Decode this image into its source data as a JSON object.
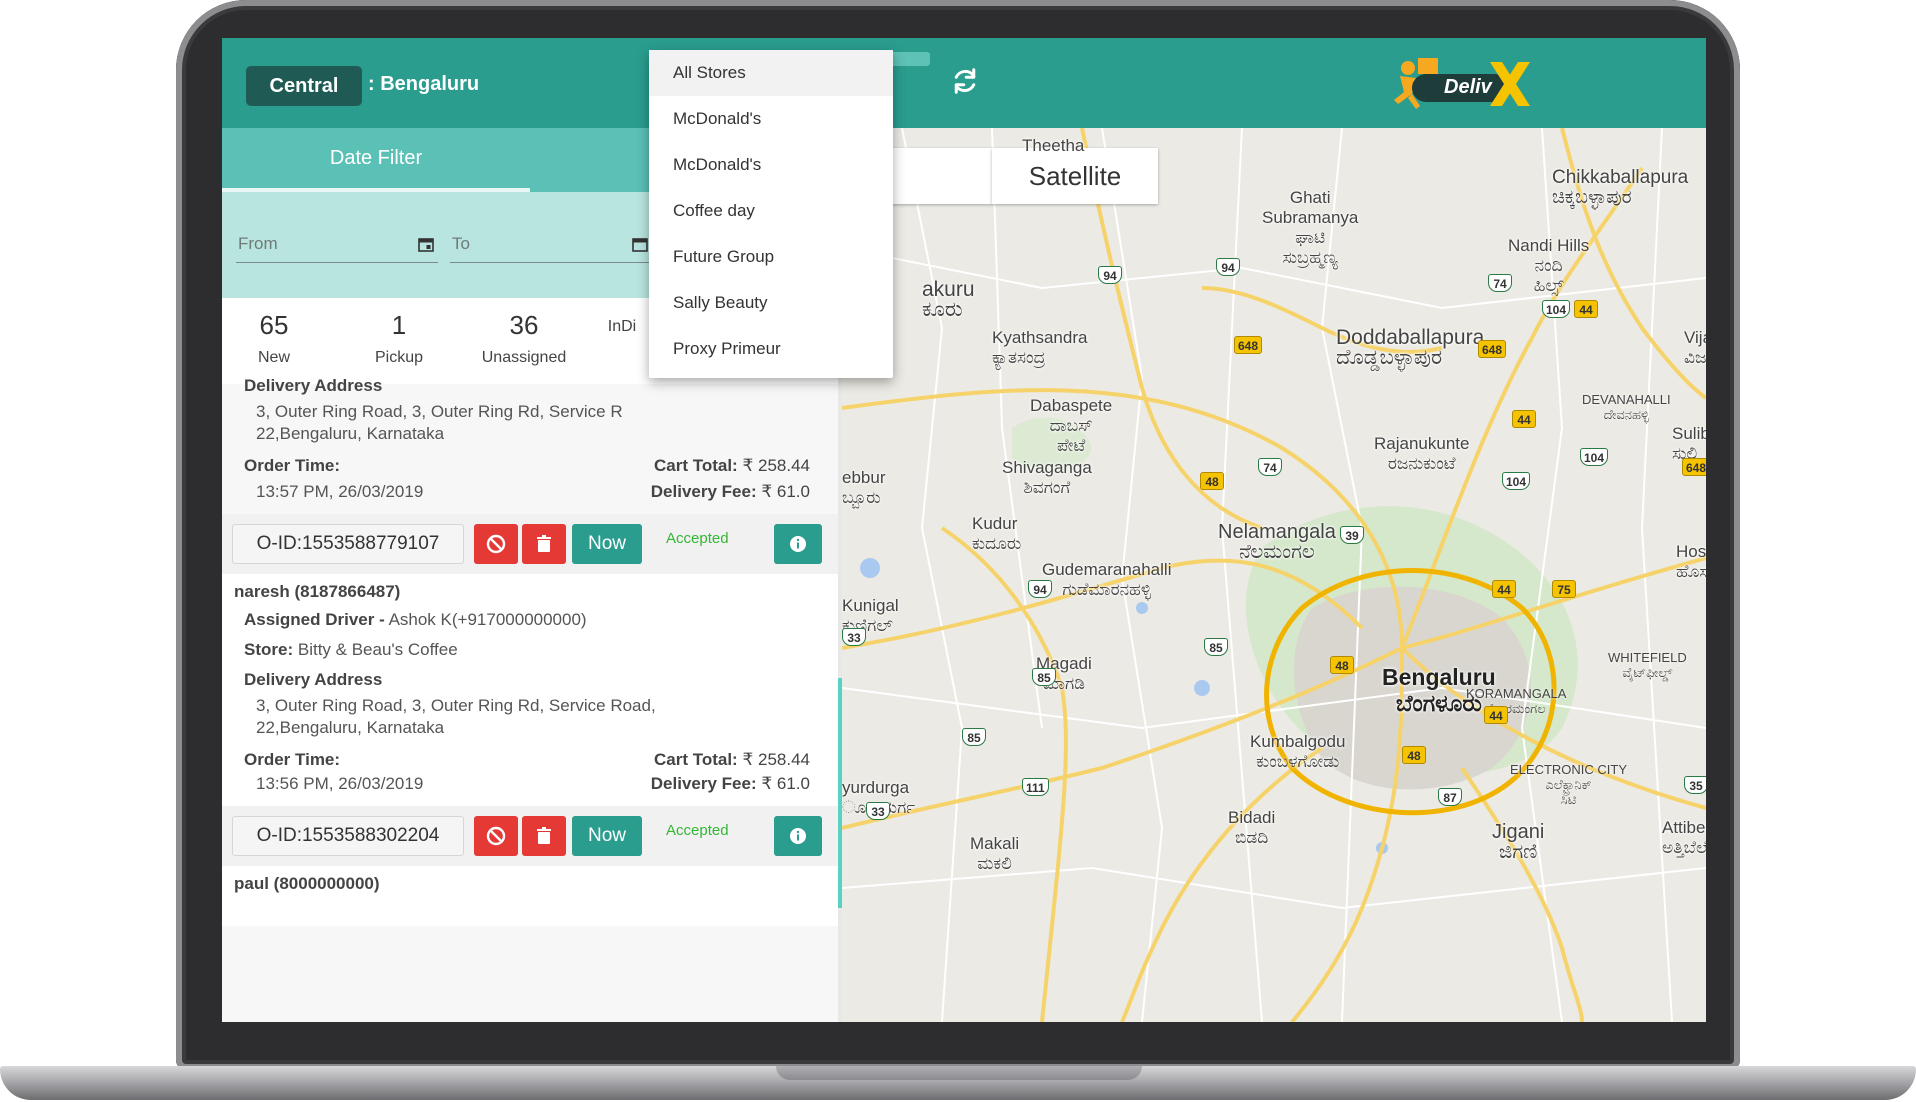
{
  "header": {
    "zone_label": "Central",
    "city_label": ": Bengaluru",
    "logo_text": "Deliv",
    "logo_x": "X"
  },
  "tabs": {
    "date_filter": "Date Filter"
  },
  "filters": {
    "from_placeholder": "From",
    "to_placeholder": "To"
  },
  "stats": [
    {
      "value": "65",
      "label": "New"
    },
    {
      "value": "1",
      "label": "Pickup"
    },
    {
      "value": "36",
      "label": "Unassigned"
    },
    {
      "value": "",
      "label": "InDi"
    }
  ],
  "order_top": {
    "delivery_address_label": "Delivery Address",
    "address_line1": "3, Outer Ring Road, 3, Outer Ring Rd, Service R",
    "address_line2": "22,Bengaluru, Karnataka",
    "order_time_label": "Order Time:",
    "order_time": "13:57 PM, 26/03/2019",
    "cart_total_label": "Cart Total:",
    "cart_total": "₹ 258.44",
    "delivery_fee_label": "Delivery Fee:",
    "delivery_fee": "₹ 61.0"
  },
  "order_1": {
    "id": "O-ID:1553588779107",
    "now_label": "Now",
    "status": "Accepted",
    "customer": "naresh (8187866487)",
    "assigned_driver_label": "Assigned Driver -",
    "assigned_driver": "Ashok K(+917000000000)",
    "store_label": "Store:",
    "store": "Bitty & Beau's Coffee",
    "delivery_address_label": "Delivery Address",
    "address_line1": "3, Outer Ring Road, 3, Outer Ring Rd, Service Road,",
    "address_line2": "22,Bengaluru, Karnataka",
    "order_time_label": "Order Time:",
    "order_time": "13:56 PM, 26/03/2019",
    "cart_total_label": "Cart Total:",
    "cart_total": "₹ 258.44",
    "delivery_fee_label": "Delivery Fee:",
    "delivery_fee": "₹ 61.0"
  },
  "order_2": {
    "id": "O-ID:1553588302204",
    "now_label": "Now",
    "status": "Accepted",
    "customer": "paul (8000000000)"
  },
  "store_dropdown": {
    "options": [
      "All Stores",
      "McDonald's",
      "McDonald's",
      "Coffee day",
      "Future Group",
      "Sally Beauty",
      "Proxy Primeur"
    ],
    "selected": "All Stores"
  },
  "map": {
    "satellite_label": "Satellite",
    "places": {
      "theertha": "Theetha",
      "ghati": "Ghati\nSubramanya\nಘಾಟಿ\nಸುಬ್ರಹ್ಮಣ್ಯ",
      "chikkaballapura": "Chikkaballapura\nಚಿಕ್ಕಬಳ್ಳಾಪುರ",
      "nandi": "Nandi Hills\nನಂದಿ\nಹಿಲ್ಸ್",
      "akuru": "akuru\nಕೂರು",
      "kyathsandra": "Kyathsandra\nಕ್ಯಾತಸಂದ್ರ",
      "doddaballapura": "Doddaballapura\nದೊಡ್ಡಬಳ್ಳಾಪುರ",
      "vijay": "Vijay\nವಿಜ",
      "dabaspete": "Dabaspete\nದಾಬಸ್\nಪೇಟೆ",
      "devanahalli": "DEVANAHALLI\nದೇವನಹಳ್ಳಿ",
      "rajanukunte": "Rajanukunte\nರಜನುಕುಂಟೆ",
      "shivaganga": "Shivaganga\nಶಿವಗಂಗೆ",
      "sulib": "Sulib\nಸುಲಿ",
      "ebbur": "ebbur\nಬ್ಬೂರು",
      "kudur": "Kudur\nಕುದೂರು",
      "nelamangala": "Nelamangala\nನೆಲಮಂಗಲ",
      "hos": "Hos\nಹೊಸ",
      "gudemaranahalli": "Gudemaranahalli\nಗುಡೆಮಾರನಹಳ್ಳಿ",
      "kunigal": "Kunigal\nಕುಣಿಗಲ್",
      "bengaluru": "Bengaluru\nಬೆಂಗಳೂರು",
      "magadi": "Magadi\nಮಾಗಡಿ",
      "whitefield": "WHITEFIELD\nವೈಟ್‌ಫೀಲ್ಡ್",
      "koramangala": "KORAMANGALA\nಕೋರಮಂಗಲ",
      "kumbalgodu": "Kumbalgodu\nಕುಂಬಳಗೋಡು",
      "electronic_city": "ELECTRONIC CITY\nಎಲೆಕ್ಟ್ರಾನಿಕ್\nಸಿಟಿ",
      "yurdurga": "yurdurga\nೂರುದುರ್ಗ",
      "bidadi": "Bidadi\nಬಿಡದಿ",
      "jigani": "Jigani\nಜಿಗಣಿ",
      "makali": "Makali\nಮಕಲಿ",
      "attibele": "Attibele\nಅತ್ತಿಬೆಲೆ"
    },
    "shields": [
      "94",
      "94",
      "74",
      "104",
      "44",
      "648",
      "648",
      "44",
      "48",
      "74",
      "104",
      "104",
      "648",
      "39",
      "44",
      "75",
      "94",
      "33",
      "85",
      "85",
      "48",
      "85",
      "44",
      "111",
      "48",
      "33",
      "87",
      "35"
    ]
  },
  "colors": {
    "header_teal": "#2a9d8f",
    "tab_teal": "#5bc0b6",
    "filter_teal": "#b9e5e0",
    "danger_red": "#e53935",
    "accepted_green": "#34b734"
  }
}
